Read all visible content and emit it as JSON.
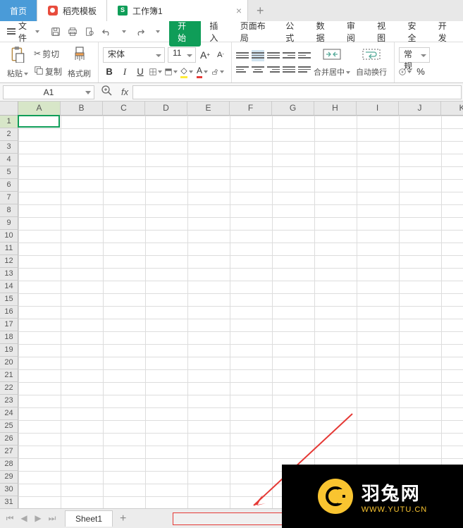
{
  "tabs": {
    "home": "首页",
    "docer": "稻壳模板",
    "workbook": "工作簿1"
  },
  "menu": {
    "file": "文件",
    "items": [
      "开始",
      "插入",
      "页面布局",
      "公式",
      "数据",
      "审阅",
      "视图",
      "安全",
      "开发"
    ]
  },
  "toolbar": {
    "paste": "粘贴",
    "cut": "剪切",
    "copy": "复制",
    "format_painter": "格式刷",
    "font_name": "宋体",
    "font_size": "11",
    "merge_center": "合并居中",
    "wrap_text": "自动换行",
    "number_format": "常规"
  },
  "formula_bar": {
    "cell_ref": "A1",
    "fx": "fx",
    "value": ""
  },
  "grid": {
    "columns": [
      "A",
      "B",
      "C",
      "D",
      "E",
      "F",
      "G",
      "H",
      "I",
      "J",
      "K"
    ],
    "row_count": 31,
    "selected_cell": "A1"
  },
  "sheets": {
    "active": "Sheet1"
  },
  "watermark": {
    "title": "羽兔网",
    "url": "WWW.YUTU.CN"
  }
}
